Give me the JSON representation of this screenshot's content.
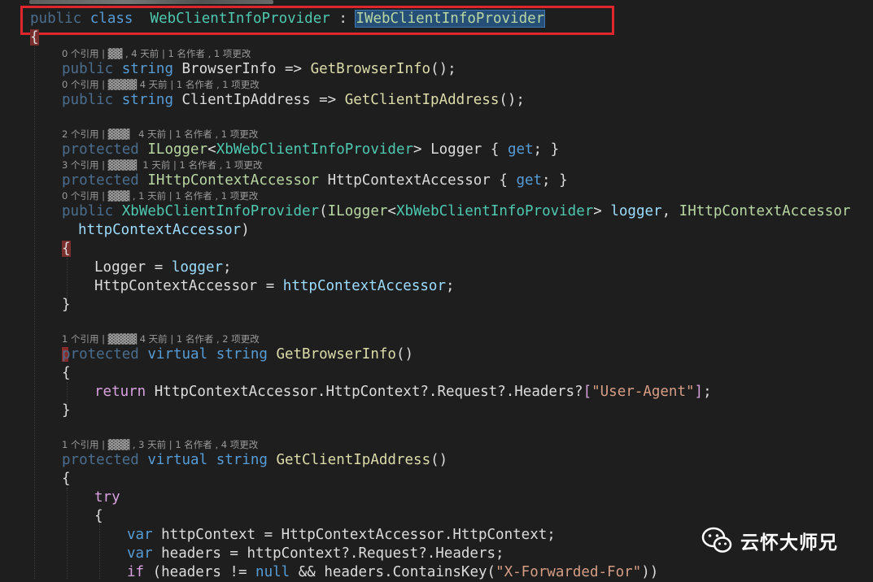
{
  "editor": {
    "theme_bg": "#1e1e1e",
    "line0": {
      "kw1": "public",
      "sp1": " ",
      "kw2": "class",
      "sp2": "  ",
      "name": "WebClientInfoProvider",
      "colon": " : ",
      "iface": "IWebClientInfoProvider"
    },
    "line1": {
      "brace": "{"
    },
    "lens1": "0 个引用 | ▓▓ , 4 天前 | 1 名作者 , 1 项更改",
    "line2": {
      "kw": "public",
      "sp": " ",
      "type": "string",
      "rest": " BrowserInfo => ",
      "mth": "GetBrowserInfo",
      "end": "();"
    },
    "lens2": "0 个引用 | ▓▓▓▓ 4 天前 | 1 名作者 , 1 项更改",
    "line3": {
      "kw": "public",
      "sp": " ",
      "type": "string",
      "rest": " ClientIpAddress => ",
      "mth": "GetClientIpAddress",
      "end": "();"
    },
    "lens3": "2 个引用 | ▓▓▓   4 天前 | 1 名作者 , 1 项更改",
    "line4": {
      "kw": "protected",
      "sp": " ",
      "t1": "ILogger",
      "lt": "<",
      "t2": "XbWebClientInfoProvider",
      "gt": ">",
      "rest": " Logger ",
      "b1": "{ ",
      "get": "get",
      "semi": "; ",
      "b2": "}"
    },
    "lens4": "3 个引用 | ▓▓▓▓  1 天前 | 1 名作者 , 1 项更改",
    "line5": {
      "kw": "protected",
      "sp": " ",
      "t1": "IHttpContextAccessor",
      "rest": " HttpContextAccessor ",
      "b1": "{ ",
      "get": "get",
      "semi": "; ",
      "b2": "}"
    },
    "lens5": "0 个引用 | ▓▓▓ , 1 天前 | 1 名作者 , 1 项更改",
    "line6": {
      "kw": "public",
      "sp": " ",
      "ctor": "XbWebClientInfoProvider",
      "p1": "(",
      "t1": "ILogger",
      "lt": "<",
      "t2": "XbWebClientInfoProvider",
      "gt": ">",
      "param1": " logger",
      "comma": ", ",
      "t3": "IHttpContextAccessor"
    },
    "line7": {
      "param": "httpContextAccessor",
      "end": ")"
    },
    "line8": {
      "brace": "{"
    },
    "line9": {
      "lhs": "Logger = ",
      "rhs": "logger",
      "end": ";"
    },
    "line10": {
      "lhs": "HttpContextAccessor = ",
      "rhs": "httpContextAccessor",
      "end": ";"
    },
    "line11": {
      "brace": "}"
    },
    "lens6": "1 个引用 | ▓▓▓▓ 4 天前 | 1 名作者 , 2 项更改",
    "line12": {
      "kw1": "protected",
      "sp1": " ",
      "kw2": "virtual",
      "sp2": " ",
      "type": "string",
      "sp3": " ",
      "mth": "GetBrowserInfo",
      "end": "()"
    },
    "line13": {
      "brace": "{"
    },
    "line14": {
      "ret": "return",
      "rest": " HttpContextAccessor.HttpContext?.Request?.Headers?",
      "b1": "[",
      "str": "\"User-Agent\"",
      "b2": "]",
      "end": ";"
    },
    "line15": {
      "brace": "}"
    },
    "lens7": "1 个引用 | ▓▓▓ , 3 天前 | 1 名作者 , 4 项更改",
    "line16": {
      "kw1": "protected",
      "sp1": " ",
      "kw2": "virtual",
      "sp2": " ",
      "type": "string",
      "sp3": " ",
      "mth": "GetClientIpAddress",
      "end": "()"
    },
    "line17": {
      "brace": "{"
    },
    "line18": {
      "kw": "try"
    },
    "line19": {
      "brace": "{"
    },
    "line20": {
      "kw": "var",
      "rest": " httpContext = HttpContextAccessor.HttpContext;"
    },
    "line21": {
      "kw": "var",
      "rest": " headers = httpContext?.Request?.Headers;"
    },
    "line22": {
      "ctl": "if",
      "rest": " (headers != ",
      "nul": "null",
      "rest2": " && headers.ContainsKey",
      "p1": "(",
      "str": "\"X-Forwarded-For\"",
      "p2": "))"
    }
  },
  "watermark": {
    "text": "云怀大师兄",
    "icon": "wechat-icon"
  }
}
